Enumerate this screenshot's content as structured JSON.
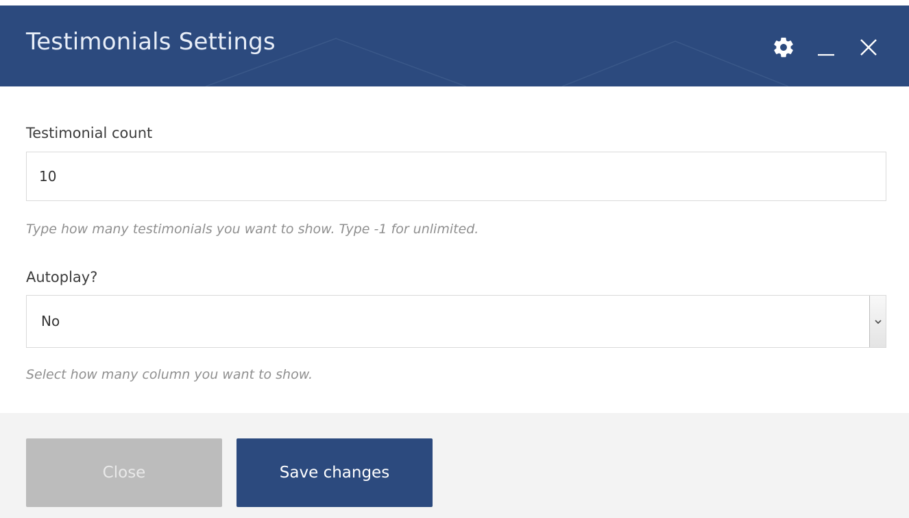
{
  "dialog": {
    "title": "Testimonials Settings",
    "header_icons": [
      "gear-icon",
      "minimize-icon",
      "close-icon"
    ]
  },
  "fields": {
    "count": {
      "label": "Testimonial count",
      "value": "10",
      "help": "Type how many testimonials you want to show. Type -1 for unlimited."
    },
    "autoplay": {
      "label": "Autoplay?",
      "selected": "No",
      "help": "Select how many column you want to show."
    }
  },
  "footer": {
    "close_label": "Close",
    "save_label": "Save changes"
  },
  "colors": {
    "header_bg": "#2c4a7e",
    "primary_button": "#2c4a7e",
    "disabled_button": "#bcbcbc",
    "footer_bg": "#f3f3f3"
  }
}
